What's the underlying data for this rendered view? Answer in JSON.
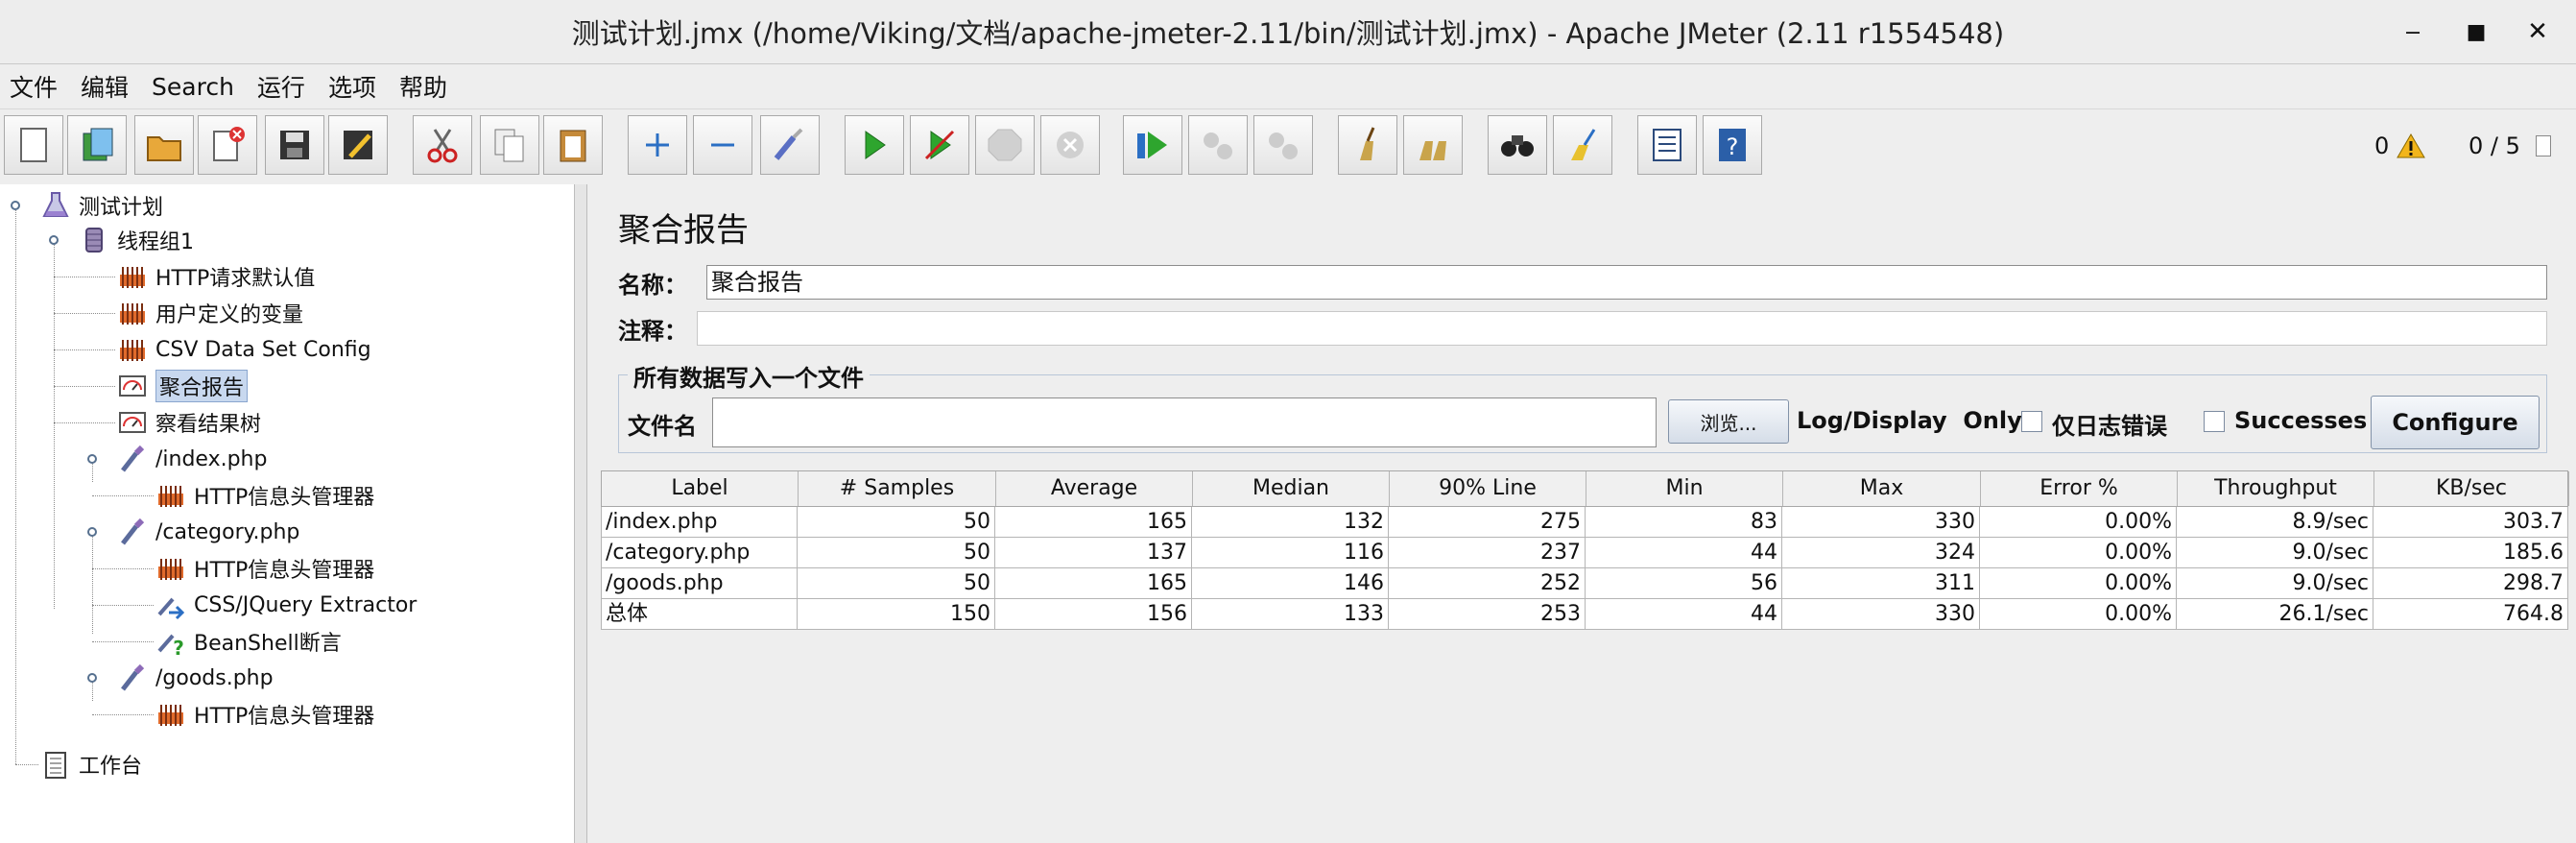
{
  "window": {
    "title": "测试计划.jmx (/home/Viking/文档/apache-jmeter-2.11/bin/测试计划.jmx) - Apache JMeter (2.11 r1554548)",
    "minimize": "‒",
    "maximize": "■",
    "close": "✕"
  },
  "menu": [
    "文件",
    "编辑",
    "Search",
    "运行",
    "选项",
    "帮助"
  ],
  "toolbar": {
    "buttons": [
      "new-icon",
      "templates-icon",
      "open-icon",
      "close-icon",
      "save-icon",
      "save-as-icon",
      "cut-icon",
      "copy-icon",
      "paste-icon",
      "expand-icon",
      "collapse-icon",
      "toggle-icon",
      "start-icon",
      "start-no-pause-icon",
      "stop-icon",
      "shutdown-icon",
      "remote-start-icon",
      "remote-stop-icon",
      "remote-exit-icon",
      "clear-icon",
      "clear-all-icon",
      "search-icon",
      "reset-search-icon",
      "function-helper-icon",
      "help-icon"
    ],
    "warnings": "0",
    "threads": "0 / 5"
  },
  "tree": [
    {
      "label": "测试计划",
      "icon": "test-plan-icon"
    },
    {
      "label": "线程组1",
      "icon": "thread-group-icon"
    },
    {
      "label": "HTTP请求默认值",
      "icon": "config-icon"
    },
    {
      "label": "用户定义的变量",
      "icon": "config-icon"
    },
    {
      "label": "CSV Data Set Config",
      "icon": "config-icon"
    },
    {
      "label": "聚合报告",
      "icon": "listener-icon"
    },
    {
      "label": "察看结果树",
      "icon": "listener-icon"
    },
    {
      "label": "/index.php",
      "icon": "sampler-icon"
    },
    {
      "label": "HTTP信息头管理器",
      "icon": "config-icon"
    },
    {
      "label": "/category.php",
      "icon": "sampler-icon"
    },
    {
      "label": "HTTP信息头管理器",
      "icon": "config-icon"
    },
    {
      "label": "CSS/JQuery Extractor",
      "icon": "extractor-icon"
    },
    {
      "label": "BeanShell断言",
      "icon": "assertion-icon"
    },
    {
      "label": "/goods.php",
      "icon": "sampler-icon"
    },
    {
      "label": "HTTP信息头管理器",
      "icon": "config-icon"
    },
    {
      "label": "工作台",
      "icon": "workbench-icon"
    }
  ],
  "panel": {
    "title": "聚合报告",
    "name_label": "名称：",
    "name_value": "聚合报告",
    "comment_label": "注释：",
    "comment_value": "",
    "file_group_title": "所有数据写入一个文件",
    "filename_label": "文件名",
    "filename_value": "",
    "browse_button": "浏览...",
    "log_display_label": "Log/Display  Only:",
    "errors_only_label": "仅日志错误",
    "successes_label": "Successes",
    "configure_button": "Configure"
  },
  "table": {
    "columns": [
      "Label",
      "# Samples",
      "Average",
      "Median",
      "90% Line",
      "Min",
      "Max",
      "Error %",
      "Throughput",
      "KB/sec"
    ],
    "rows": [
      [
        "/index.php",
        "50",
        "165",
        "132",
        "275",
        "83",
        "330",
        "0.00%",
        "8.9/sec",
        "303.7"
      ],
      [
        "/category.php",
        "50",
        "137",
        "116",
        "237",
        "44",
        "324",
        "0.00%",
        "9.0/sec",
        "185.6"
      ],
      [
        "/goods.php",
        "50",
        "165",
        "146",
        "252",
        "56",
        "311",
        "0.00%",
        "9.0/sec",
        "298.7"
      ],
      [
        "总体",
        "150",
        "156",
        "133",
        "253",
        "44",
        "330",
        "0.00%",
        "26.1/sec",
        "764.8"
      ]
    ]
  }
}
